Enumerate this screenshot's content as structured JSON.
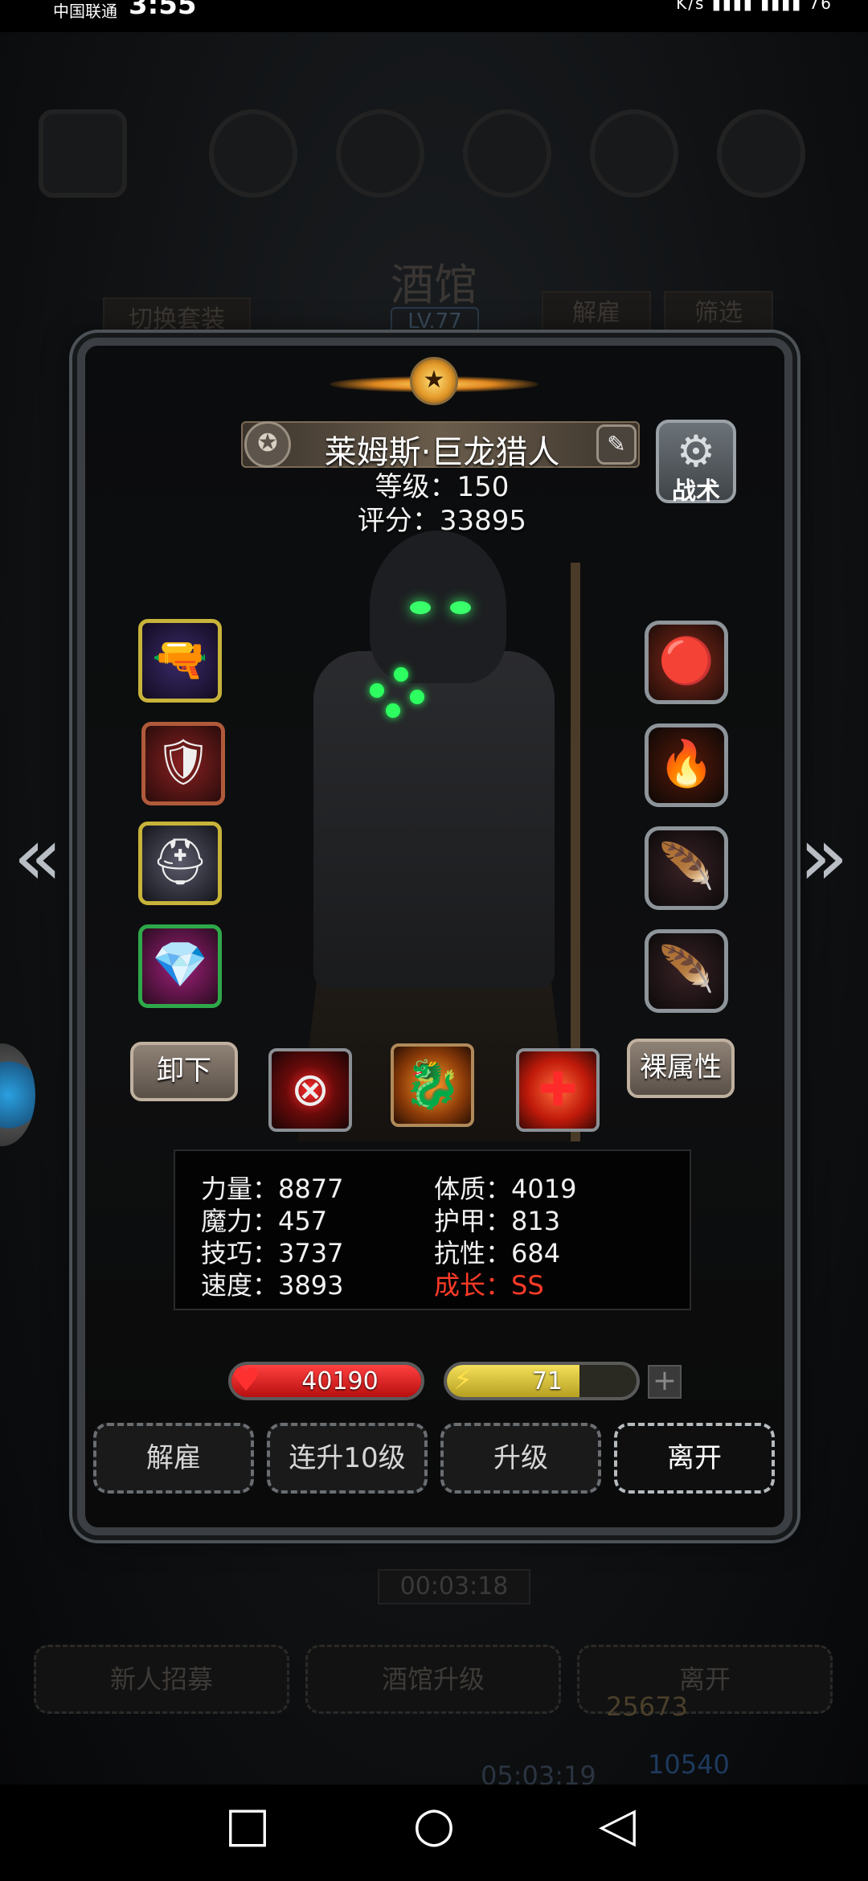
{
  "status_bar": {
    "carrier": "中国联通",
    "time": "3:55",
    "right_text": "K/s ▮▮▮▮ ▮▮▮▮ 76"
  },
  "background": {
    "title": "酒馆",
    "level": "LV.77",
    "switch_outfit": "切换套装",
    "dismiss": "解雇",
    "filter": "筛选",
    "timer": "00:03:18",
    "recruit": "新人招募",
    "tavern_upgrade": "酒馆升级",
    "leave": "离开",
    "resource1": "25673",
    "resource2": "10540",
    "timer2": "05:03:19"
  },
  "hero": {
    "name": "莱姆斯·巨龙猎人",
    "level_line": "等级：150",
    "score_line": "评分：33895"
  },
  "tactics_label": "战术",
  "buttons": {
    "unequip": "卸下",
    "base_attr": "裸属性",
    "dismiss": "解雇",
    "upgrade10": "连升10级",
    "upgrade": "升级",
    "leave": "离开",
    "plus": "+"
  },
  "stats": {
    "strength": "力量：8877",
    "magic": "魔力：457",
    "skill": "技巧：3737",
    "speed": "速度：3893",
    "constitution": "体质：4019",
    "armor": "护甲：813",
    "resistance": "抗性：684",
    "growth": "成长：SS"
  },
  "bars": {
    "hp": "40190",
    "energy": "71",
    "energy_fraction": 0.7
  },
  "icons": {
    "left_slots": [
      "pistol-icon",
      "dragon-armor-icon",
      "silver-helm-icon",
      "crystal-gauntlet-icon"
    ],
    "right_slots": [
      "fire-orb-icon",
      "flame-rune-icon",
      "feather-icon",
      "feather-icon"
    ],
    "skills": [
      "target-skill-icon",
      "dragon-skill-icon",
      "heal-cross-icon"
    ]
  }
}
